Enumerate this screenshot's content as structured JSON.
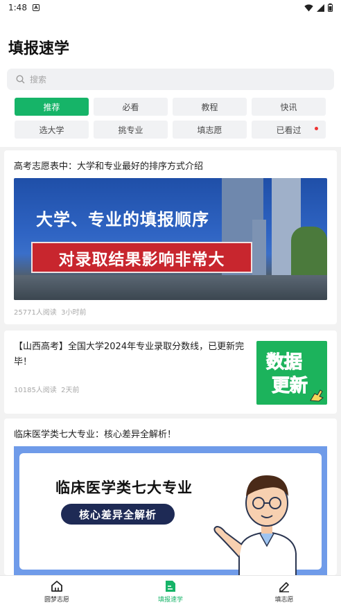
{
  "status_bar": {
    "time": "1:48",
    "notification_badge": "A"
  },
  "header": {
    "title": "填报速学"
  },
  "search": {
    "placeholder": "搜索"
  },
  "tags": [
    {
      "label": "推荐",
      "active": true
    },
    {
      "label": "必看"
    },
    {
      "label": "教程"
    },
    {
      "label": "快讯"
    },
    {
      "label": "选大学"
    },
    {
      "label": "挑专业"
    },
    {
      "label": "填志愿"
    },
    {
      "label": "已看过",
      "has_dot": true
    }
  ],
  "articles": [
    {
      "title": "高考志愿表中：大学和专业最好的排序方式介绍",
      "banner_line1": "大学、专业的填报顺序",
      "banner_line2": "对录取结果影响非常大",
      "reads": "25771人阅读",
      "time": "3小时前"
    },
    {
      "title": "【山西高考】全国大学2024年专业录取分数线，已更新完毕！",
      "thumb_line1": "数据",
      "thumb_line2": "更新",
      "reads": "10185人阅读",
      "time": "2天前"
    },
    {
      "title": "临床医学类七大专业：核心差异全解析！",
      "banner_title": "临床医学类七大专业",
      "banner_pill": "核心差异全解析"
    }
  ],
  "tabbar": [
    {
      "label": "圆梦志愿",
      "icon": "home-icon"
    },
    {
      "label": "填报速学",
      "icon": "document-icon",
      "active": true
    },
    {
      "label": "填志愿",
      "icon": "pencil-icon"
    }
  ],
  "colors": {
    "accent": "#16b468",
    "badge_red": "#e33333"
  }
}
